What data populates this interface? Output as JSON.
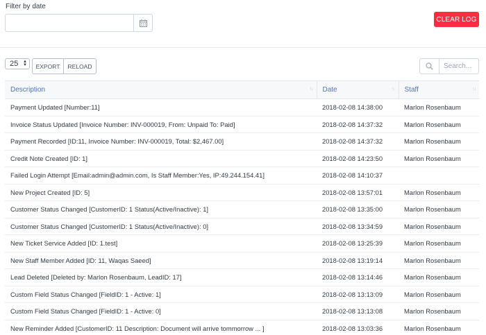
{
  "filter": {
    "label": "Filter by date",
    "date_value": "",
    "date_icon": "calendar-icon"
  },
  "clear_log_label": "Clear Log",
  "toolbar": {
    "page_length": "25",
    "export_label": "EXPORT",
    "reload_label": "RELOAD",
    "search_placeholder": "Search...",
    "search_icon": "search-icon"
  },
  "colors": {
    "clear_button": "#fc2d42",
    "header_text": "#4e75ad",
    "header_bg": "#f6f8fa"
  },
  "table": {
    "columns": [
      "Description",
      "Date",
      "Staff"
    ],
    "rows": [
      [
        "Payment Updated [Number:11]",
        "2018-02-08 14:38:00",
        "Marlon Rosenbaum"
      ],
      [
        "Invoice Status Updated [Invoice Number: INV-000019, From: Unpaid To: Paid]",
        "2018-02-08 14:37:32",
        "Marlon Rosenbaum"
      ],
      [
        "Payment Recorded [ID:11, Invoice Number: INV-000019, Total: $2,467.00]",
        "2018-02-08 14:37:32",
        "Marlon Rosenbaum"
      ],
      [
        "Credit Note Created [ID: 1]",
        "2018-02-08 14:23:50",
        "Marlon Rosenbaum"
      ],
      [
        "Failed Login Attempt [Email:admin@admin.com, Is Staff Member:Yes, IP:49.244.154.41]",
        "2018-02-08 14:10:37",
        ""
      ],
      [
        "New Project Created [ID: 5]",
        "2018-02-08 13:57:01",
        "Marlon Rosenbaum"
      ],
      [
        "Customer Status Changed [CustomerID: 1 Status(Active/Inactive): 1]",
        "2018-02-08 13:35:00",
        "Marlon Rosenbaum"
      ],
      [
        "Customer Status Changed [CustomerID: 1 Status(Active/Inactive): 0]",
        "2018-02-08 13:34:59",
        "Marlon Rosenbaum"
      ],
      [
        "New Ticket Service Added [ID: 1.test]",
        "2018-02-08 13:25:39",
        "Marlon Rosenbaum"
      ],
      [
        "New Staff Member Added [ID: 11, Waqas Saeed]",
        "2018-02-08 13:19:14",
        "Marlon Rosenbaum"
      ],
      [
        "Lead Deleted [Deleted by: Marlon Rosenbaum, LeadID: 17]",
        "2018-02-08 13:14:46",
        "Marlon Rosenbaum"
      ],
      [
        "Custom Field Status Changed [FieldID: 1 - Active: 1]",
        "2018-02-08 13:13:09",
        "Marlon Rosenbaum"
      ],
      [
        "Custom Field Status Changed [FieldID: 1 - Active: 0]",
        "2018-02-08 13:13:08",
        "Marlon Rosenbaum"
      ],
      [
        "New Reminder Added [CustomerID: 11 Description: Document will arrive tommorrow ... ]",
        "2018-02-08 13:03:36",
        "Marlon Rosenbaum"
      ]
    ]
  }
}
